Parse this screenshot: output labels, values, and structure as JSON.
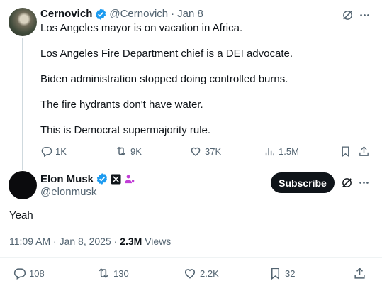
{
  "parent_tweet": {
    "display_name": "Cernovich",
    "handle": "@Cernovich",
    "separator": "·",
    "date": "Jan 8",
    "paragraphs": [
      "Los Angeles mayor is on vacation in Africa.",
      "Los Angeles Fire Department chief is a DEI advocate.",
      "Biden administration stopped doing controlled burns.",
      "The fire hydrants don't have water.",
      "This is Democrat supermajority rule."
    ],
    "stats": {
      "replies": "1K",
      "reposts": "9K",
      "likes": "37K",
      "views": "1.5M"
    }
  },
  "main_tweet": {
    "display_name": "Elon Musk",
    "handle": "@elonmusk",
    "subscribe_label": "Subscribe",
    "text": "Yeah",
    "time": "11:09 AM",
    "dot": "·",
    "date": "Jan 8, 2025",
    "dot2": "·",
    "views_count": "2.3M",
    "views_label": "Views",
    "stats": {
      "replies": "108",
      "reposts": "130",
      "likes": "2.2K",
      "bookmarks": "32"
    }
  },
  "colors": {
    "verified_blue": "#1d9bf0",
    "text_primary": "#0f1419",
    "text_secondary": "#536471",
    "subscribe_bg": "#0f1419",
    "affiliate_pink": "#c13dd6"
  }
}
